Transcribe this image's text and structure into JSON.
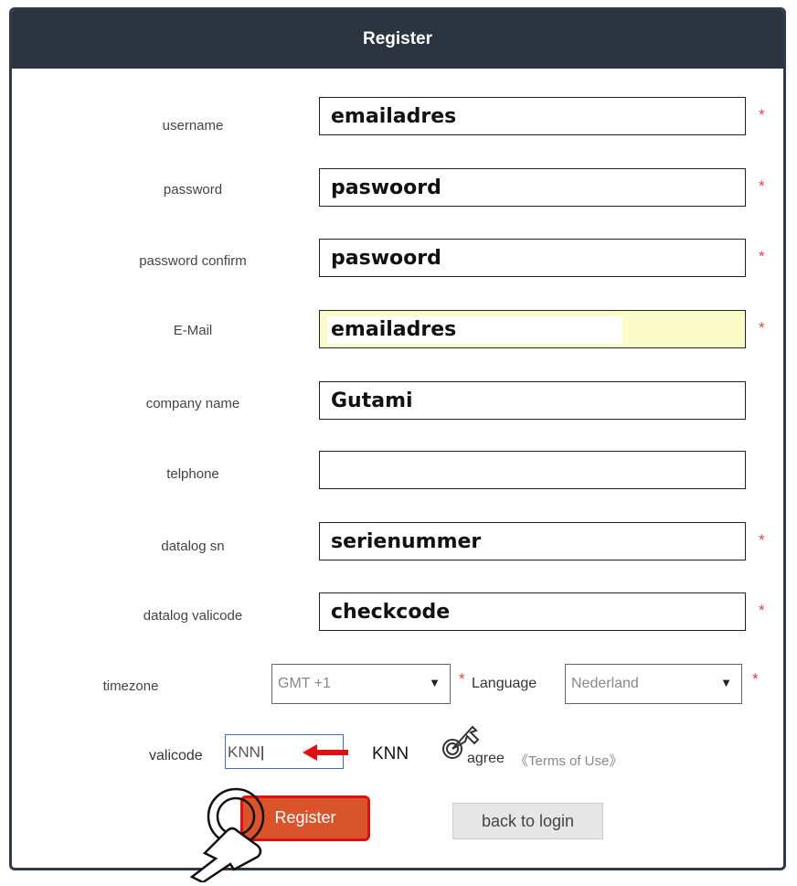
{
  "header": {
    "title": "Register"
  },
  "form": {
    "username": {
      "label": "username",
      "value": "emailadres"
    },
    "password": {
      "label": "password",
      "value": "paswoord"
    },
    "password_confirm": {
      "label": "password confirm",
      "value": "paswoord"
    },
    "email": {
      "label": "E-Mail",
      "value": "emailadres"
    },
    "company_name": {
      "label": "company name",
      "value": "Gutami"
    },
    "telephone": {
      "label": "telphone",
      "value": ""
    },
    "datalog_sn": {
      "label": "datalog sn",
      "value": "serienummer"
    },
    "datalog_valicode": {
      "label": "datalog valicode",
      "value": "checkcode"
    },
    "timezone": {
      "label": "timezone",
      "value": "GMT +1"
    },
    "language": {
      "label": "Language",
      "value": "Nederland"
    },
    "valicode": {
      "label": "valicode",
      "value": "KNN",
      "captcha": "KNN"
    },
    "required_mark": "*",
    "agree": {
      "label": "agree",
      "terms_link": "《Terms of Use》"
    }
  },
  "buttons": {
    "register": "Register",
    "back_to_login": "back to login"
  },
  "colors": {
    "header_bg": "#2c3440",
    "required": "#dd4444",
    "register_btn": "#d9542b",
    "highlight": "#e01010"
  },
  "icons": [
    "tap-hand-icon",
    "arrow-left-icon",
    "select-arrow-icon"
  ]
}
